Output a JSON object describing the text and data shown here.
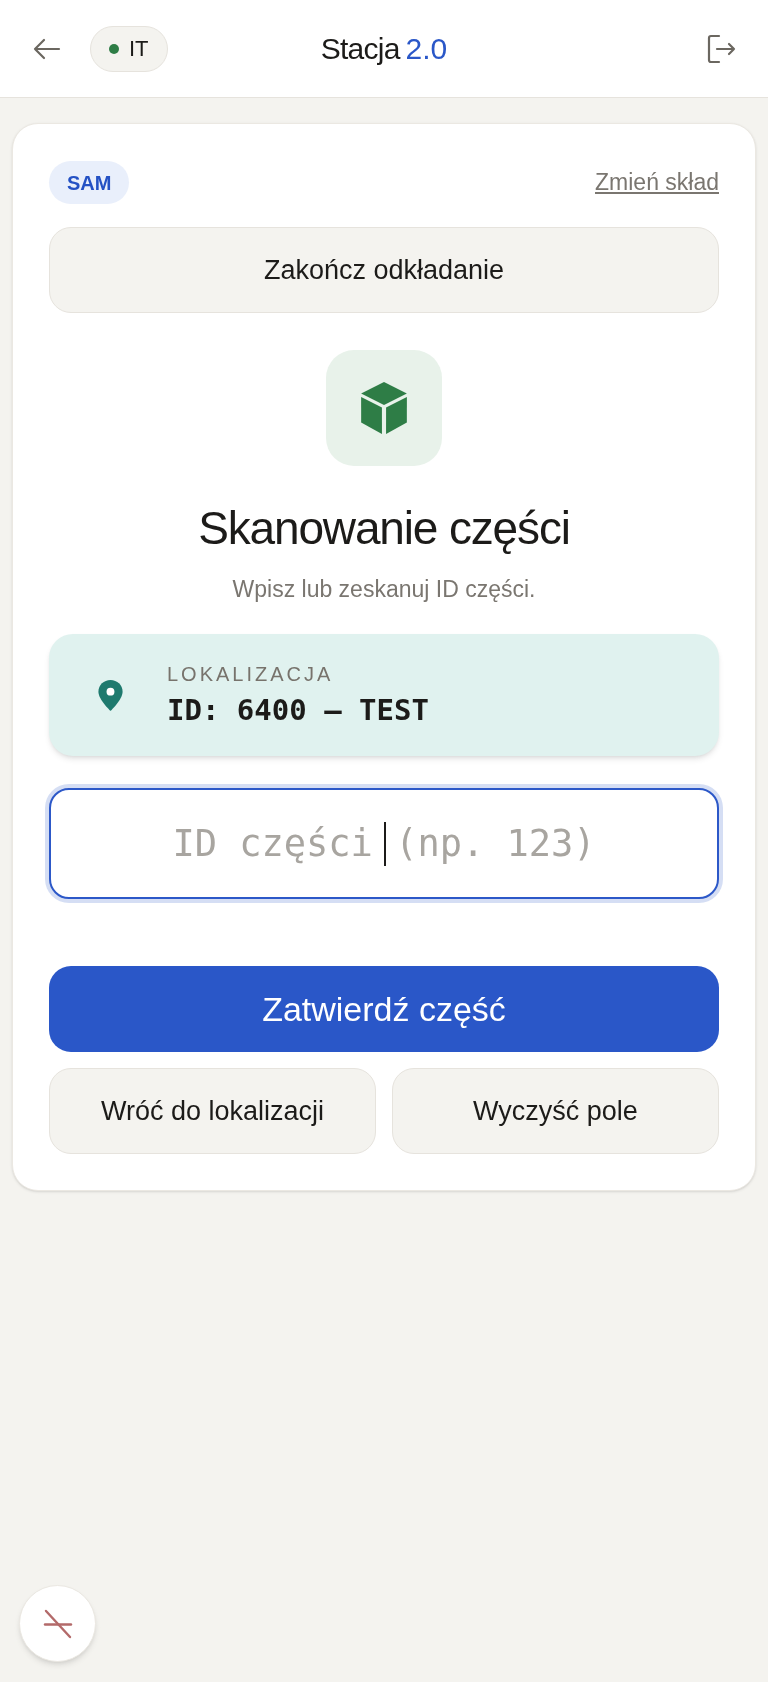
{
  "header": {
    "env_badge": {
      "label": "IT"
    },
    "title": "Stacja",
    "version": "2.0"
  },
  "card": {
    "mode_badge": "SAM",
    "change_link": "Zmień skład",
    "finish_button": "Zakończ odkładanie",
    "title": "Skanowanie części",
    "subtitle": "Wpisz lub zeskanuj ID części.",
    "location": {
      "label": "LOKALIZACJA",
      "value": "ID: 6400 — TEST"
    },
    "part_input": {
      "placeholder": "ID części (np. 123)",
      "focused": true
    },
    "confirm_button": "Zatwierdź część",
    "secondary_buttons": [
      "Wróć do lokalizacji",
      "Wyczyść pole"
    ]
  }
}
